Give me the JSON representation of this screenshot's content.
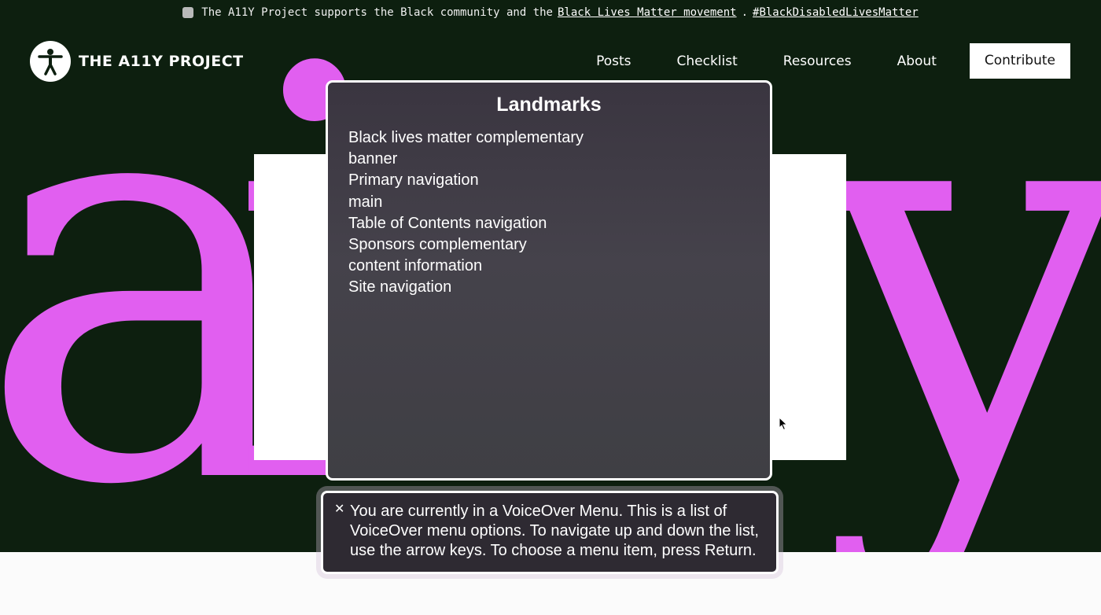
{
  "banner": {
    "text_before": "The A11Y Project supports the Black community and the",
    "link_blm": "Black Lives Matter movement",
    "separator": ".",
    "link_hashtag": "#BlackDisabledLivesMatter"
  },
  "header": {
    "logo_text": "THE A11Y PROJECT",
    "nav": [
      {
        "label": "Posts"
      },
      {
        "label": "Checklist"
      },
      {
        "label": "Resources"
      },
      {
        "label": "About"
      }
    ],
    "contribute_label": "Contribute"
  },
  "hero": {
    "letters": [
      "a",
      "i",
      "y"
    ],
    "accent_color": "#e15ff0",
    "background_color": "#0d1f0f"
  },
  "voiceover_menu": {
    "title": "Landmarks",
    "items": [
      "Black lives matter complementary",
      "banner",
      "Primary navigation",
      "main",
      "Table of Contents navigation",
      "Sponsors complementary",
      "content information",
      "Site navigation"
    ]
  },
  "voiceover_hint": {
    "close_icon": "close-icon",
    "text": "You are currently in a VoiceOver Menu. This is a list of VoiceOver menu options. To navigate up and down the list, use the arrow keys. To choose a menu item, press Return."
  }
}
